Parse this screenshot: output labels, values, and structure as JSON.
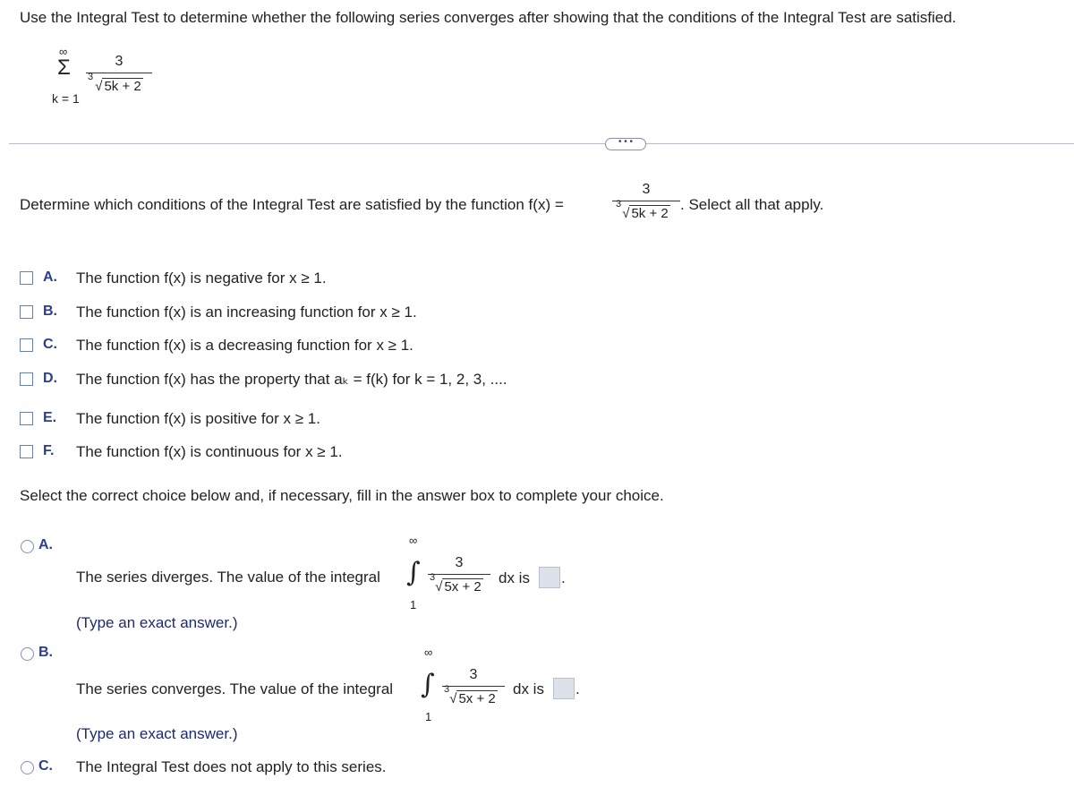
{
  "instruction": "Use the Integral Test to determine whether the following series converges after showing that the conditions of the Integral Test are satisfied.",
  "series": {
    "upper": "∞",
    "sigma": "Σ",
    "lower": "k = 1",
    "numerator": "3",
    "root_index": "3",
    "radicand": "5k + 2"
  },
  "more_button": "• • •",
  "question1": {
    "prefix": "Determine which conditions of the Integral Test are satisfied by the function f(x) =",
    "numerator": "3",
    "root_index": "3",
    "radicand": "5k + 2",
    "suffix": ". Select all that apply."
  },
  "conditions": [
    {
      "letter": "A.",
      "text": "The function f(x) is negative for x ≥ 1.",
      "checked": false
    },
    {
      "letter": "B.",
      "text": "The function f(x) is an increasing function for x ≥ 1.",
      "checked": false
    },
    {
      "letter": "C.",
      "text": "The function f(x) is a decreasing function for x ≥ 1.",
      "checked": false
    },
    {
      "letter": "D.",
      "text": "The function f(x) has the property that aₖ = f(k) for k = 1, 2, 3, ....",
      "checked": false
    },
    {
      "letter": "E.",
      "text": "The function f(x) is positive for x ≥ 1.",
      "checked": false
    },
    {
      "letter": "F.",
      "text": "The function f(x) is continuous for x ≥ 1.",
      "checked": false
    }
  ],
  "question2": "Select the correct choice below and, if necessary, fill in the answer box to complete your choice.",
  "choices": [
    {
      "letter": "A.",
      "text": "The series diverges. The value of the integral",
      "upper": "∞",
      "lower": "1",
      "integral": "∫",
      "numerator": "3",
      "root_index": "3",
      "radicand": "5x + 2",
      "dx": "dx is",
      "period": ".",
      "answer": "",
      "hint": "(Type an exact answer.)"
    },
    {
      "letter": "B.",
      "text": "The series converges. The value of the integral",
      "upper": "∞",
      "lower": "1",
      "integral": "∫",
      "numerator": "3",
      "root_index": "3",
      "radicand": "5x + 2",
      "dx": "dx is",
      "period": ".",
      "answer": "",
      "hint": "(Type an exact answer.)"
    },
    {
      "letter": "C.",
      "text": "The Integral Test does not apply to this series."
    }
  ]
}
